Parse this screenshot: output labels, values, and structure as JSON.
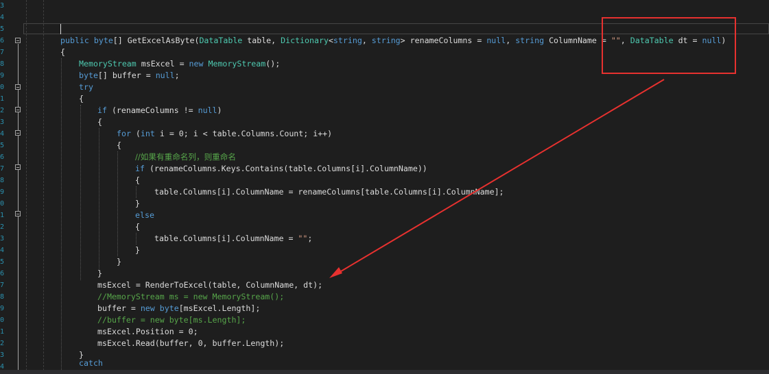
{
  "editor": {
    "line_numbers": [
      "3",
      "4",
      "5",
      "6",
      "7",
      "8",
      "9",
      "0",
      "1",
      "2",
      "3",
      "4",
      "5",
      "6",
      "7",
      "8",
      "9",
      "0",
      "1",
      "2",
      "3",
      "4",
      "5",
      "6",
      "7",
      "8",
      "9",
      "0",
      "1",
      "2",
      "3",
      "4"
    ],
    "code": {
      "signature": {
        "kw_public": "public",
        "kw_byte": "byte",
        "brackets": "[] ",
        "method": "GetExcelAsByte(",
        "type_datatable": "DataTable",
        "p_table": " table, ",
        "type_dictionary": "Dictionary",
        "lt": "<",
        "kw_string1": "string",
        "comma": ", ",
        "kw_string2": "string",
        "gt_rename": "> renameColumns = ",
        "kw_null1": "null",
        "comma2": ", ",
        "kw_string3": "string",
        "p_colname": " ColumnName = ",
        "str_empty": "\"\"",
        "comma3": ", ",
        "type_datatable2": "DataTable",
        "p_dt": " dt = ",
        "kw_null2": "null",
        "close": ")"
      },
      "open_brace_1": "{",
      "line_ms_type": "MemoryStream",
      "line_ms_mid": " msExcel = ",
      "line_ms_new": "new",
      "line_ms_type2": " MemoryStream",
      "line_ms_end": "();",
      "line_buf_kw": "byte",
      "line_buf_mid": "[] buffer = ",
      "line_buf_null": "null",
      "line_buf_end": ";",
      "try_kw": "try",
      "open_brace_2": "{",
      "if_kw": "if",
      "if_mid": " (renameColumns != ",
      "if_null": "null",
      "if_end": ")",
      "open_brace_3": "{",
      "for_kw": "for",
      "for_a": " (",
      "for_int": "int",
      "for_rest": " i = 0; i < table.Columns.Count; i++)",
      "open_brace_4": "{",
      "comment_cn": "//如果有重命名列，则重命名",
      "if2_kw": "if",
      "if2_rest": " (renameColumns.Keys.Contains(table.Columns[i].ColumnName))",
      "open_brace_5": "{",
      "assign_1": "table.Columns[i].ColumnName = renameColumns[table.Columns[i].ColumnName];",
      "close_brace_5": "}",
      "else_kw": "else",
      "open_brace_6": "{",
      "assign_2a": "table.Columns[i].ColumnName = ",
      "assign_2str": "\"\"",
      "assign_2end": ";",
      "close_brace_6": "}",
      "close_brace_4": "}",
      "close_brace_3": "}",
      "render_line": "msExcel = RenderToExcel(table, ColumnName, dt);",
      "comment_ms": "//MemoryStream ms = new MemoryStream();",
      "buf_a": "buffer = ",
      "buf_new": "new",
      "buf_byte": " byte",
      "buf_end": "[msExcel.Length];",
      "comment_buf": "//buffer = new byte[ms.Length];",
      "pos_line": "msExcel.Position = 0;",
      "read_line": "msExcel.Read(buffer, 0, buffer.Length);",
      "close_brace_2": "}",
      "catch_kw": "catch"
    }
  },
  "annotation": {
    "box_color": "#e8312f",
    "arrow_color": "#e8312f"
  }
}
